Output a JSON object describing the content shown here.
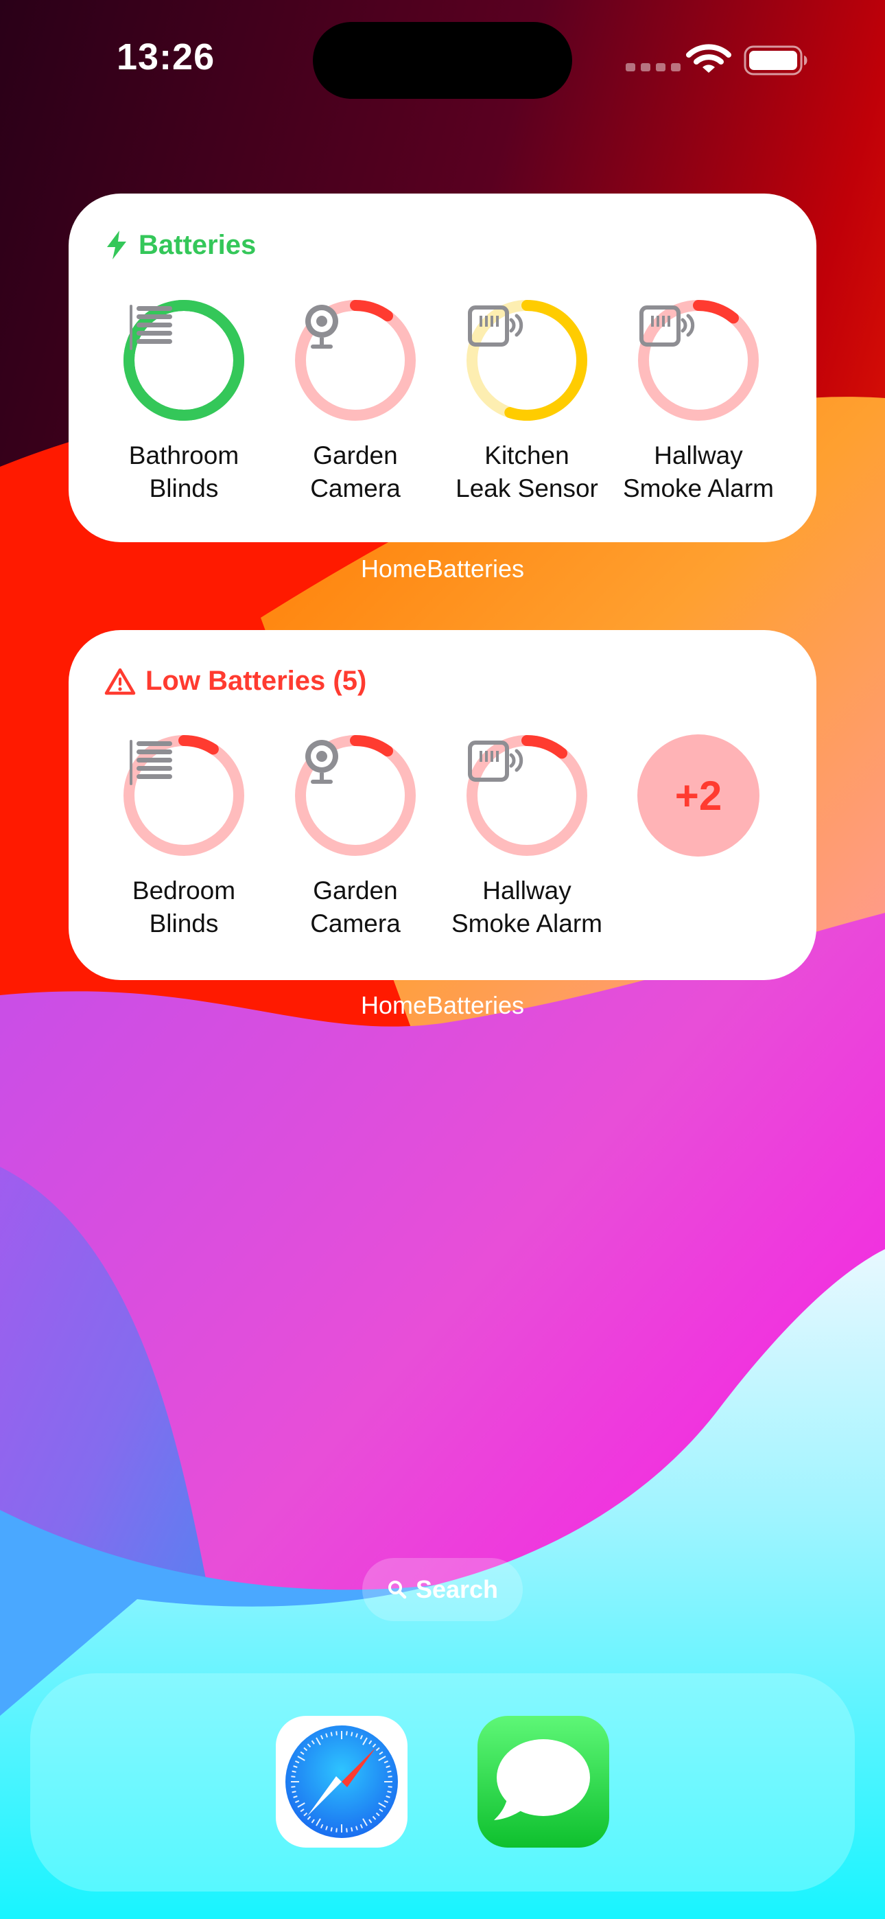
{
  "status_bar": {
    "time": "13:26"
  },
  "widgets": [
    {
      "title": "Batteries",
      "caption": "HomeBatteries",
      "devices": [
        {
          "line1": "Bathroom",
          "line2": "Blinds",
          "icon": "blinds-icon",
          "level": 1.0,
          "color": "#34c759",
          "track": "#34c759"
        },
        {
          "line1": "Garden",
          "line2": "Camera",
          "icon": "camera-icon",
          "level": 0.1,
          "color": "#ff3b30",
          "track": "#ffbcbd"
        },
        {
          "line1": "Kitchen",
          "line2": "Leak Sensor",
          "icon": "sensor-icon",
          "level": 0.55,
          "color": "#ffcc00",
          "track": "#fdeeb1"
        },
        {
          "line1": "Hallway",
          "line2": "Smoke Alarm",
          "icon": "sensor-icon",
          "level": 0.11,
          "color": "#ff3b30",
          "track": "#ffbcbd"
        }
      ]
    },
    {
      "title": "Low Batteries (5)",
      "caption": "HomeBatteries",
      "devices": [
        {
          "line1": "Bedroom",
          "line2": "Blinds",
          "icon": "blinds-icon",
          "level": 0.09,
          "color": "#ff3b30",
          "track": "#ffbcbd"
        },
        {
          "line1": "Garden",
          "line2": "Camera",
          "icon": "camera-icon",
          "level": 0.1,
          "color": "#ff3b30",
          "track": "#ffbcbd"
        },
        {
          "line1": "Hallway",
          "line2": "Smoke Alarm",
          "icon": "sensor-icon",
          "level": 0.11,
          "color": "#ff3b30",
          "track": "#ffbcbd"
        }
      ],
      "more": "+2"
    }
  ],
  "search": {
    "label": "Search"
  },
  "dock": [
    {
      "name": "Safari",
      "icon": "safari-icon"
    },
    {
      "name": "Messages",
      "icon": "messages-icon"
    }
  ]
}
